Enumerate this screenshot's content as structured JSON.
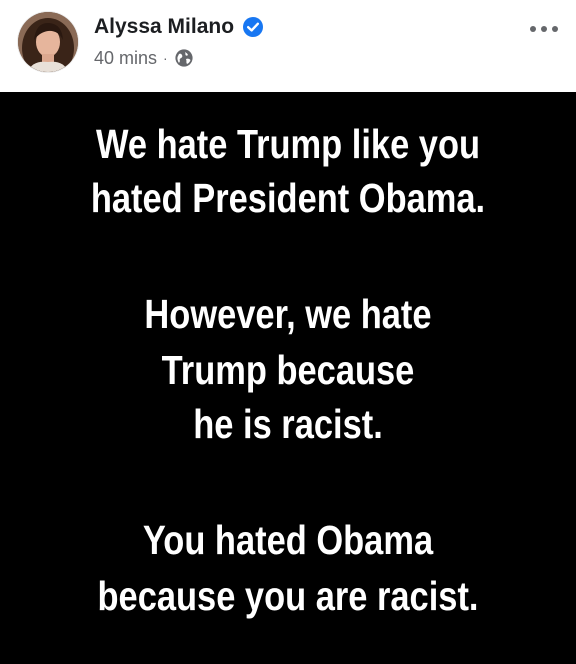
{
  "post": {
    "author": "Alyssa Milano",
    "timestamp": "40 mins",
    "separator": "·",
    "privacy_icon": "globe-icon",
    "verified_icon": "verified-badge-icon",
    "more_icon": "more-options-icon",
    "accent_color": "#1877f2"
  },
  "meme": {
    "background": "#000000",
    "text_color": "#ffffff",
    "lines": [
      "We hate Trump like you",
      "hated President Obama.",
      "However, we hate",
      "Trump because",
      "he is racist.",
      "You hated Obama",
      "because you are racist."
    ]
  }
}
